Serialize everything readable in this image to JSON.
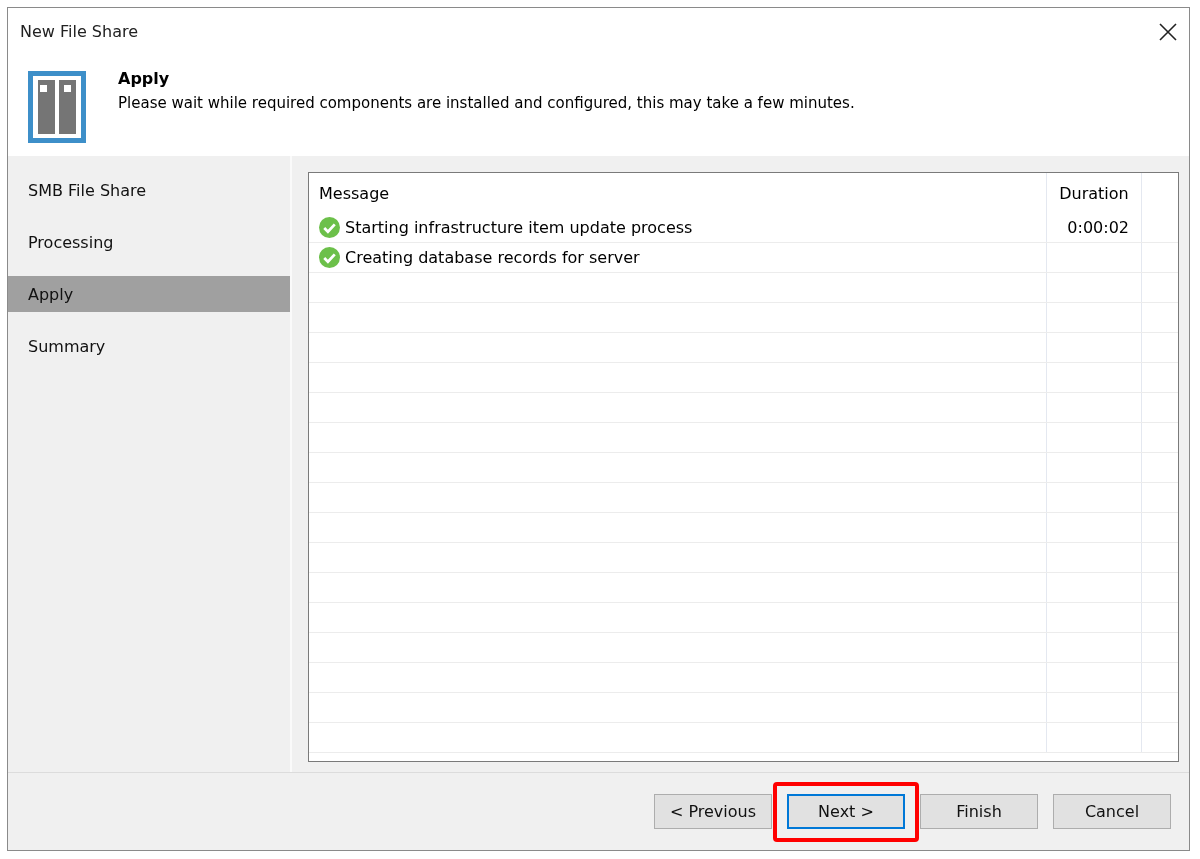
{
  "window": {
    "title": "New File Share"
  },
  "header": {
    "title": "Apply",
    "description": "Please wait while required components are installed and configured, this may take a few minutes."
  },
  "sidebar": {
    "items": [
      {
        "label": "SMB File Share",
        "selected": false
      },
      {
        "label": "Processing",
        "selected": false
      },
      {
        "label": "Apply",
        "selected": true
      },
      {
        "label": "Summary",
        "selected": false
      }
    ]
  },
  "table": {
    "columns": [
      "Message",
      "Duration"
    ],
    "rows": [
      {
        "completed": true,
        "message": "Starting infrastructure item update process",
        "duration": "0:00:02"
      },
      {
        "completed": true,
        "message": "Creating database records for server"
      }
    ]
  },
  "buttons": [
    {
      "label": "< Previous",
      "focused": false,
      "highlighted": false
    },
    {
      "label": "Next >",
      "focused": true,
      "highlighted": true
    },
    {
      "label": "Finish",
      "focused": false,
      "highlighted": false
    },
    {
      "label": "Cancel",
      "focused": false,
      "highlighted": false
    }
  ]
}
